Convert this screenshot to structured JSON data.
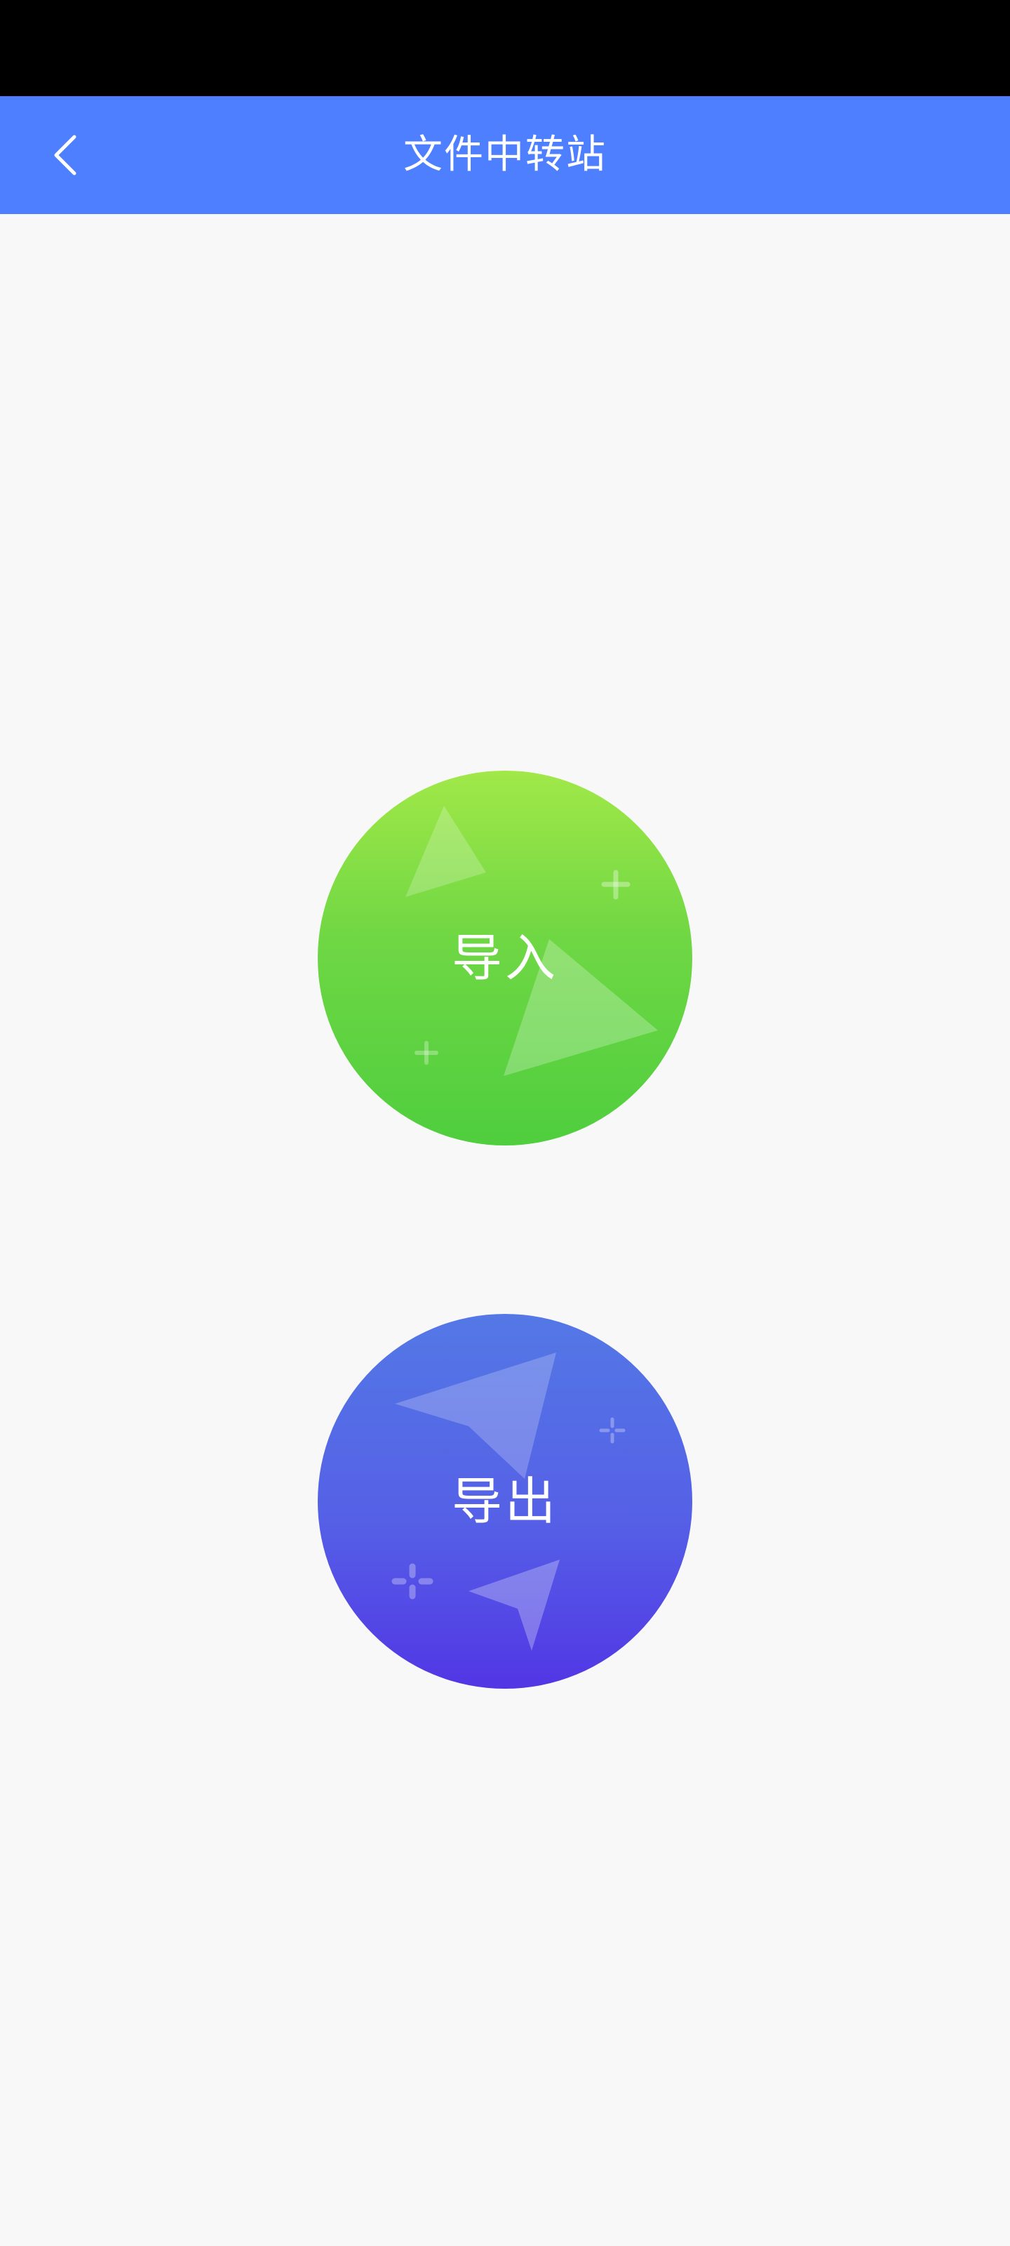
{
  "app_bar": {
    "title": "文件中转站",
    "back_icon": "chevron-left-icon",
    "background_color": "#4d7ffe"
  },
  "actions": {
    "import_label": "导入",
    "export_label": "导出"
  },
  "colors": {
    "import_gradient": [
      "#a1e848",
      "#4fce3e"
    ],
    "export_gradient": [
      "#5478e6",
      "#5236e5"
    ],
    "page_background": "#f8f8f8"
  }
}
